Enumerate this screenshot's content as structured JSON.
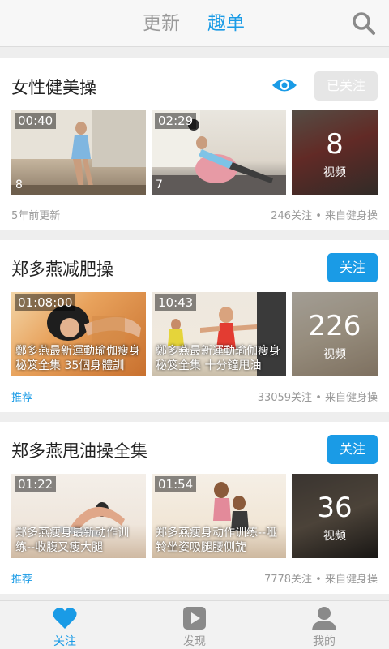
{
  "header": {
    "tabs": [
      {
        "label": "更新",
        "active": false
      },
      {
        "label": "趣单",
        "active": true
      }
    ],
    "search_icon": "search-icon"
  },
  "cards": [
    {
      "title": "女性健美操",
      "follow_label": "已关注",
      "followed": true,
      "show_eye_icon": true,
      "thumbs": [
        {
          "duration": "00:40",
          "count": "8",
          "caption": ""
        },
        {
          "duration": "02:29",
          "count": "7",
          "caption": ""
        }
      ],
      "more_count": "8",
      "more_label": "视频",
      "meta_left": "5年前更新",
      "meta_right": "246关注 • 来自健身操"
    },
    {
      "title": "郑多燕减肥操",
      "follow_label": "关注",
      "followed": false,
      "thumbs": [
        {
          "duration": "01:08:00",
          "caption": "鄭多燕最新運動瑜伽瘦身秘笈全集 35個身體訓"
        },
        {
          "duration": "10:43",
          "caption": "鄭多燕最新運動瑜伽瘦身秘笈全集 十分鐘甩油"
        }
      ],
      "more_count": "226",
      "more_label": "视频",
      "meta_left": "推荐",
      "meta_right": "33059关注 • 来自健身操"
    },
    {
      "title": "郑多燕甩油操全集",
      "follow_label": "关注",
      "followed": false,
      "thumbs": [
        {
          "duration": "01:22",
          "caption": "郑多燕瘦身最新动作训练--收腹又瘦大腿"
        },
        {
          "duration": "01:54",
          "caption": "郑多燕瘦身动作训练--哑铃坐姿吸腿腰侧旋"
        }
      ],
      "more_count": "36",
      "more_label": "视频",
      "meta_left": "推荐",
      "meta_right": "7778关注 • 来自健身操"
    }
  ],
  "bottom_nav": [
    {
      "label": "关注",
      "icon": "heart-icon",
      "active": true
    },
    {
      "label": "发现",
      "icon": "play-icon",
      "active": false
    },
    {
      "label": "我的",
      "icon": "user-icon",
      "active": false
    }
  ],
  "colors": {
    "accent": "#1a9be6",
    "muted": "#9a9a9a"
  }
}
